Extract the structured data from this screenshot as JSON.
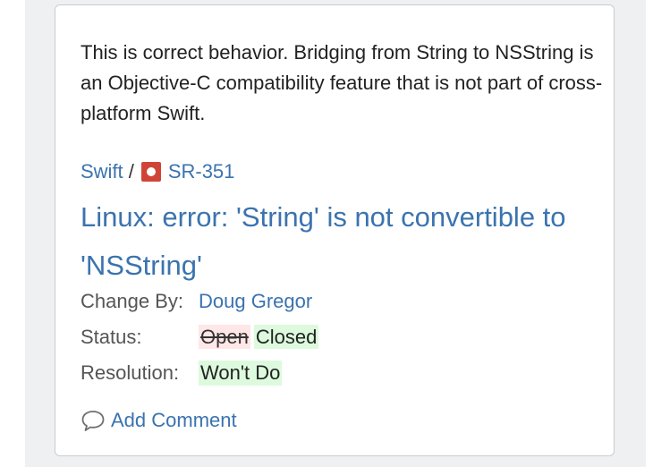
{
  "comment": {
    "text": "This is correct behavior. Bridging from String to NSString is an Objective-C compatibility feature that is not part of cross-platform Swift."
  },
  "breadcrumb": {
    "project": "Swift",
    "separator": "/",
    "issue_key": "SR-351",
    "issue_type_icon": "bug-icon"
  },
  "issue": {
    "title": "Linux: error: 'String' is not convertible to 'NSString'"
  },
  "fields": {
    "change_by": {
      "label": "Change By:",
      "value": "Doug Gregor"
    },
    "status": {
      "label": "Status:",
      "old_value": "Open",
      "new_value": "Closed"
    },
    "resolution": {
      "label": "Resolution:",
      "new_value": "Won't Do"
    }
  },
  "actions": {
    "add_comment_label": "Add Comment",
    "add_comment_icon": "speech-bubble-icon"
  },
  "colors": {
    "link": "#3b73af",
    "removed_bg": "#ffe7e7",
    "added_bg": "#ddfade",
    "bug": "#d04437"
  }
}
